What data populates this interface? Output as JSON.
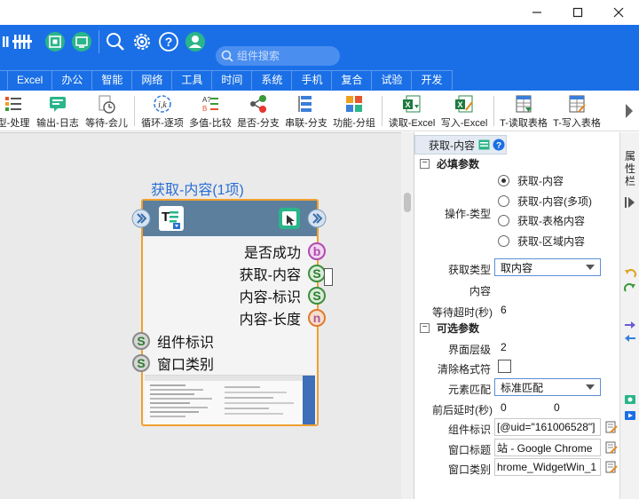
{
  "window": {
    "controls": {
      "minimize": "minimize-icon",
      "maximize": "maximize-icon",
      "close": "close-icon"
    }
  },
  "header": {
    "search_placeholder": "组件搜索",
    "tabs": [
      "Excel",
      "办公",
      "智能",
      "网络",
      "工具",
      "时间",
      "系统",
      "手机",
      "复合",
      "试验",
      "开发"
    ]
  },
  "toolbar": {
    "items": [
      {
        "label": "型-处理",
        "icon": "process-icon"
      },
      {
        "label": "输出-日志",
        "icon": "log-icon"
      },
      {
        "label": "等待-会儿",
        "icon": "wait-icon"
      },
      {
        "label": "循环-逐项",
        "icon": "loop-icon"
      },
      {
        "label": "多值-比较",
        "icon": "compare-icon"
      },
      {
        "label": "是否-分支",
        "icon": "branch-icon"
      },
      {
        "label": "串联-分支",
        "icon": "serial-branch-icon"
      },
      {
        "label": "功能-分组",
        "icon": "group-icon"
      },
      {
        "label": "读取-Excel",
        "icon": "excel-read-icon"
      },
      {
        "label": "写入-Excel",
        "icon": "excel-write-icon"
      },
      {
        "label": "T-读取表格",
        "icon": "table-read-icon"
      },
      {
        "label": "T-写入表格",
        "icon": "table-write-icon"
      }
    ]
  },
  "node": {
    "title": "获取-内容(1项)",
    "outputs": [
      {
        "label": "是否成功",
        "type": "b"
      },
      {
        "label": "获取-内容",
        "type": "S"
      },
      {
        "label": "内容-标识",
        "type": "S"
      },
      {
        "label": "内容-长度",
        "type": "n"
      }
    ],
    "inputs": [
      {
        "label": "组件标识",
        "type": "S"
      },
      {
        "label": "窗口类别",
        "type": "S"
      }
    ]
  },
  "panel": {
    "tab_label": "获取-内容",
    "required_section": "必填参数",
    "optional_section": "可选参数",
    "operation_label": "操作-类型",
    "operation_options": [
      "获取-内容",
      "获取-内容(多项)",
      "获取-表格内容",
      "获取-区域内容"
    ],
    "operation_selected": "获取-内容",
    "fetch_type_label": "获取类型",
    "fetch_type_value": "取内容",
    "content_label": "内容",
    "content_value": "",
    "timeout_label": "等待超时(秒)",
    "timeout_value": "6",
    "ui_level_label": "界面层级",
    "ui_level_value": "2",
    "clear_format_label": "清除格式符",
    "element_match_label": "元素匹配",
    "element_match_value": "标准匹配",
    "delay_label": "前后延时(秒)",
    "delay_before": "0",
    "delay_after": "0",
    "component_id_label": "组件标识",
    "component_id_value": "[@uid=\"161006528\"]",
    "window_title_label": "窗口标题",
    "window_title_value": "站 - Google Chrome",
    "window_class_label": "窗口类别",
    "window_class_value": "hrome_WidgetWin_1"
  },
  "sidebar_right": {
    "label": "属性栏"
  }
}
